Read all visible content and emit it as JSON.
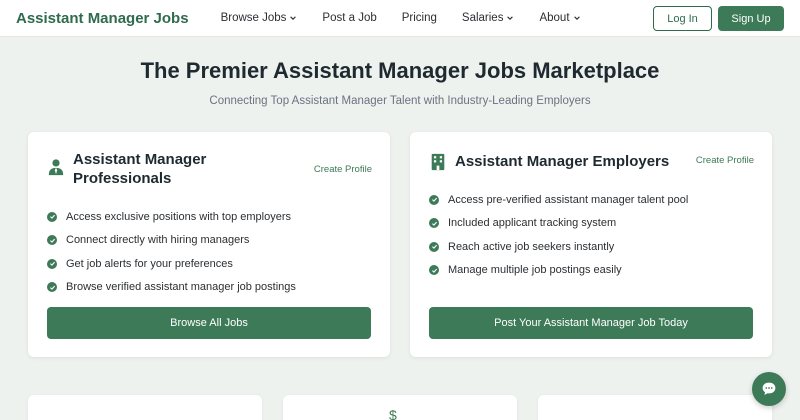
{
  "nav": {
    "brand": "Assistant Manager Jobs",
    "items": [
      {
        "label": "Browse Jobs",
        "has_dropdown": true
      },
      {
        "label": "Post a Job",
        "has_dropdown": false
      },
      {
        "label": "Pricing",
        "has_dropdown": false
      },
      {
        "label": "Salaries",
        "has_dropdown": true
      },
      {
        "label": "About",
        "has_dropdown": true
      }
    ],
    "login_label": "Log In",
    "signup_label": "Sign Up"
  },
  "hero": {
    "title": "The Premier Assistant Manager Jobs Marketplace",
    "subtitle": "Connecting Top Assistant Manager Talent with Industry-Leading Employers"
  },
  "cards": [
    {
      "icon": "user-tie-icon",
      "title": "Assistant Manager Professionals",
      "link": "Create Profile",
      "features": [
        "Access exclusive positions with top employers",
        "Connect directly with hiring managers",
        "Get job alerts for your preferences",
        "Browse verified assistant manager job postings"
      ],
      "button": "Browse All Jobs"
    },
    {
      "icon": "building-icon",
      "title": "Assistant Manager Employers",
      "link": "Create Profile",
      "features": [
        "Access pre-verified assistant manager talent pool",
        "Included applicant tracking system",
        "Reach active job seekers instantly",
        "Manage multiple job postings easily"
      ],
      "button": "Post Your Assistant Manager Job Today"
    }
  ],
  "bottom": {
    "dollar_glyph": "$"
  },
  "colors": {
    "accent": "#3d7a57",
    "brand": "#2f6b4c",
    "background": "#eef2ef"
  }
}
